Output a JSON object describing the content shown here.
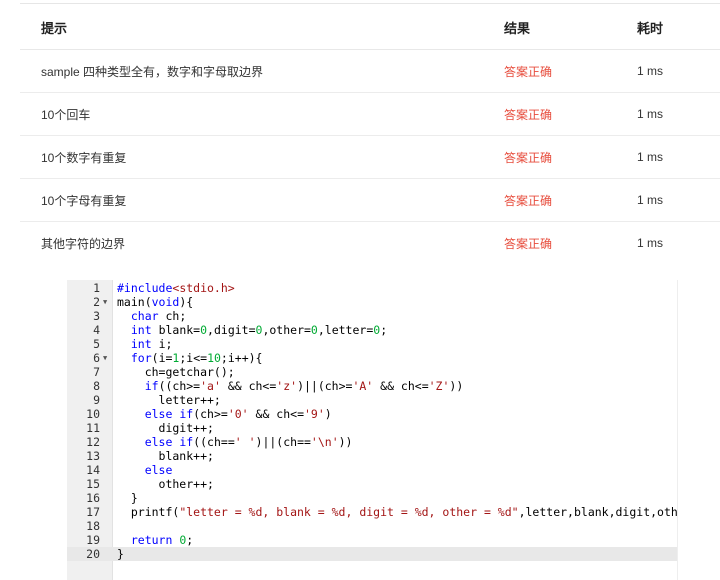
{
  "table": {
    "headers": {
      "hint": "提示",
      "result": "结果",
      "time": "耗时"
    },
    "rows": [
      {
        "hint": "sample 四种类型全有，数字和字母取边界",
        "result": "答案正确",
        "time": "1 ms"
      },
      {
        "hint": "10个回车",
        "result": "答案正确",
        "time": "1 ms"
      },
      {
        "hint": "10个数字有重复",
        "result": "答案正确",
        "time": "1 ms"
      },
      {
        "hint": "10个字母有重复",
        "result": "答案正确",
        "time": "1 ms"
      },
      {
        "hint": "其他字符的边界",
        "result": "答案正确",
        "time": "1 ms"
      }
    ]
  },
  "colors": {
    "result_ok": "#e74c3c",
    "keyword": "#0000ff",
    "string": "#a31515"
  },
  "editor": {
    "active_line": 20,
    "folded_lines": [
      2,
      6
    ],
    "lines": [
      "#include<stdio.h>",
      "main(void){",
      "  char ch;",
      "  int blank=0,digit=0,other=0,letter=0;",
      "  int i;",
      "  for(i=1;i<=10;i++){",
      "    ch=getchar();",
      "    if((ch>='a' && ch<='z')||(ch>='A' && ch<='Z'))",
      "      letter++;",
      "    else if(ch>='0' && ch<='9')",
      "      digit++;",
      "    else if((ch==' ')||(ch=='\\n'))",
      "      blank++;",
      "    else",
      "      other++;",
      "  }",
      "  printf(\"letter = %d, blank = %d, digit = %d, other = %d\",letter,blank,digit,other);",
      "",
      "  return 0;",
      "}"
    ]
  }
}
